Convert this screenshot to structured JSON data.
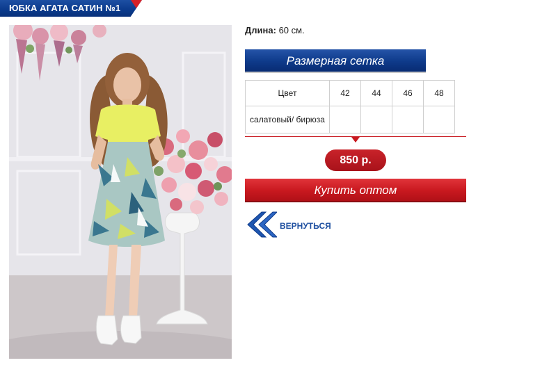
{
  "product": {
    "title": "ЮБКА АГАТА САТИН №1",
    "photo_icon": "product-photo"
  },
  "specs": {
    "length_label": "Длина:",
    "length_value": "60 см."
  },
  "size_grid": {
    "header": "Размерная сетка",
    "color_col": "Цвет",
    "sizes": [
      "42",
      "44",
      "46",
      "48"
    ],
    "rows": [
      {
        "color": "салатовый/ бирюза",
        "cells": [
          "",
          "",
          "",
          ""
        ]
      }
    ]
  },
  "price": "850 р.",
  "actions": {
    "buy_label": "Купить оптом",
    "back_label": "ВЕРНУТЬСЯ",
    "back_icon": "double-chevron-left-icon"
  },
  "colors": {
    "brand_blue": "#0e3a8a",
    "accent_red": "#c8181f",
    "link_blue": "#1e4fa0"
  }
}
